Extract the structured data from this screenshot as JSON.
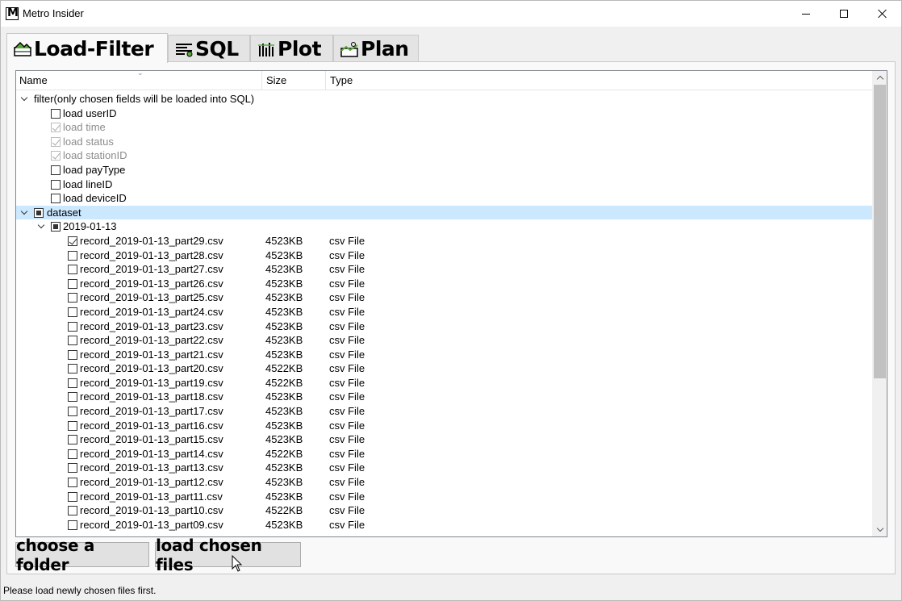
{
  "window": {
    "title": "Metro Insider"
  },
  "tabs": [
    {
      "label": "Load-Filter",
      "icon": "mountain-icon",
      "active": true
    },
    {
      "label": "SQL",
      "icon": "sql-icon",
      "active": false
    },
    {
      "label": "Plot",
      "icon": "plot-icon",
      "active": false
    },
    {
      "label": "Plan",
      "icon": "plan-icon",
      "active": false
    }
  ],
  "tree": {
    "columns": {
      "name": "Name",
      "size": "Size",
      "type": "Type"
    },
    "filter": {
      "label": "filter(only chosen fields will be loaded into SQL)",
      "items": [
        {
          "label": "load userID",
          "checked": false,
          "disabled": false
        },
        {
          "label": "load time",
          "checked": true,
          "disabled": true
        },
        {
          "label": "load status",
          "checked": true,
          "disabled": true
        },
        {
          "label": "load stationID",
          "checked": true,
          "disabled": true
        },
        {
          "label": "load payType",
          "checked": false,
          "disabled": false
        },
        {
          "label": "load lineID",
          "checked": false,
          "disabled": false
        },
        {
          "label": "load deviceID",
          "checked": false,
          "disabled": false
        }
      ]
    },
    "dataset": {
      "label": "dataset",
      "folder": "2019-01-13",
      "files": [
        {
          "name": "record_2019-01-13_part29.csv",
          "size": "4523KB",
          "type": "csv File",
          "checked": true
        },
        {
          "name": "record_2019-01-13_part28.csv",
          "size": "4523KB",
          "type": "csv File",
          "checked": false
        },
        {
          "name": "record_2019-01-13_part27.csv",
          "size": "4523KB",
          "type": "csv File",
          "checked": false
        },
        {
          "name": "record_2019-01-13_part26.csv",
          "size": "4523KB",
          "type": "csv File",
          "checked": false
        },
        {
          "name": "record_2019-01-13_part25.csv",
          "size": "4523KB",
          "type": "csv File",
          "checked": false
        },
        {
          "name": "record_2019-01-13_part24.csv",
          "size": "4523KB",
          "type": "csv File",
          "checked": false
        },
        {
          "name": "record_2019-01-13_part23.csv",
          "size": "4523KB",
          "type": "csv File",
          "checked": false
        },
        {
          "name": "record_2019-01-13_part22.csv",
          "size": "4523KB",
          "type": "csv File",
          "checked": false
        },
        {
          "name": "record_2019-01-13_part21.csv",
          "size": "4523KB",
          "type": "csv File",
          "checked": false
        },
        {
          "name": "record_2019-01-13_part20.csv",
          "size": "4522KB",
          "type": "csv File",
          "checked": false
        },
        {
          "name": "record_2019-01-13_part19.csv",
          "size": "4522KB",
          "type": "csv File",
          "checked": false
        },
        {
          "name": "record_2019-01-13_part18.csv",
          "size": "4523KB",
          "type": "csv File",
          "checked": false
        },
        {
          "name": "record_2019-01-13_part17.csv",
          "size": "4523KB",
          "type": "csv File",
          "checked": false
        },
        {
          "name": "record_2019-01-13_part16.csv",
          "size": "4523KB",
          "type": "csv File",
          "checked": false
        },
        {
          "name": "record_2019-01-13_part15.csv",
          "size": "4523KB",
          "type": "csv File",
          "checked": false
        },
        {
          "name": "record_2019-01-13_part14.csv",
          "size": "4522KB",
          "type": "csv File",
          "checked": false
        },
        {
          "name": "record_2019-01-13_part13.csv",
          "size": "4523KB",
          "type": "csv File",
          "checked": false
        },
        {
          "name": "record_2019-01-13_part12.csv",
          "size": "4523KB",
          "type": "csv File",
          "checked": false
        },
        {
          "name": "record_2019-01-13_part11.csv",
          "size": "4523KB",
          "type": "csv File",
          "checked": false
        },
        {
          "name": "record_2019-01-13_part10.csv",
          "size": "4522KB",
          "type": "csv File",
          "checked": false
        },
        {
          "name": "record_2019-01-13_part09.csv",
          "size": "4523KB",
          "type": "csv File",
          "checked": false
        }
      ]
    }
  },
  "buttons": {
    "choose_folder": "choose a folder",
    "load_files": "load chosen files"
  },
  "status": "Please load newly chosen files first."
}
